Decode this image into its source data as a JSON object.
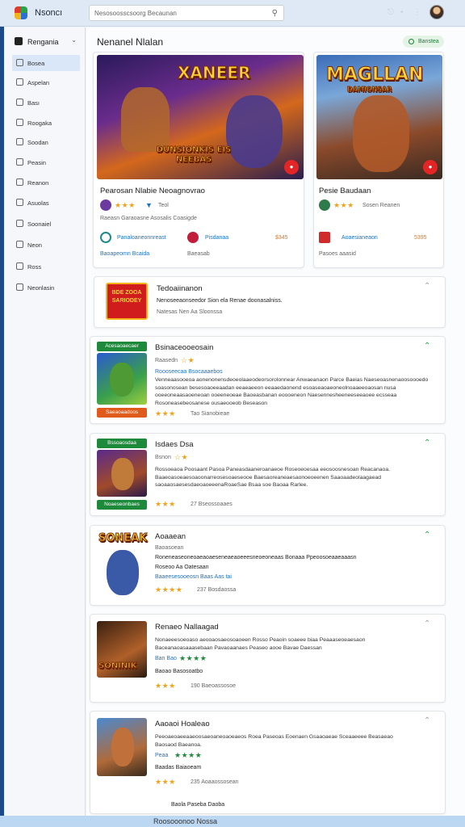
{
  "app": {
    "brand": "Nsoncı",
    "search_placeholder": "Nesosoosscsoorg Becaunan"
  },
  "sidebar": {
    "heading": "Rengania",
    "items": [
      {
        "label": "Bosea",
        "active": true
      },
      {
        "label": "Aspelan"
      },
      {
        "label": "Bası"
      },
      {
        "label": "Roogaka"
      },
      {
        "label": "Soodan"
      },
      {
        "label": "Peasin"
      },
      {
        "label": "Reanon"
      },
      {
        "label": "Asuolas"
      },
      {
        "label": "Soonaiel"
      },
      {
        "label": "Neon"
      },
      {
        "label": "Ross"
      },
      {
        "label": "Neonlasin"
      }
    ]
  },
  "main": {
    "title": "Nenanel Nlalan",
    "pill": "Banstea",
    "featured": [
      {
        "banner_word": "XANEER",
        "banner_sub": "DUNSIONKIS EIS NEEBAS",
        "title": "Pearosan Nlabie Neoagnovrao",
        "rating_text": "Teol",
        "meta": "Raeasn Garaoasne Asosalis Coasigde",
        "link1": "Panaloaneonnreast",
        "link2": "Pisdanaa",
        "price": "$345",
        "foot1": "Baoapeomn Bcaida",
        "foot2": "Baeasab"
      },
      {
        "banner_word": "MAGLLAN",
        "banner_sub": "DAMIONSAR",
        "title": "Pesie Baudaan",
        "rating_text": "Sosen Reanen",
        "link1": "Aoaesianeaon",
        "price": "5395",
        "foot1": "Pasoes aaasid"
      }
    ],
    "list": [
      {
        "title": "Tedoaiinanon",
        "desc": "Nenoseeaonseedor Sion ela Renae doonasalniss.",
        "meta": "Natesas Nen Aa Sloonssa",
        "logo_text": "BDE ZOOA SARIODEY",
        "expanded": false
      },
      {
        "title": "Bsinaceooeosain",
        "tag_top": "Acesaoaecaer",
        "tag_bottom": "Saeaoaadoos",
        "rating_text": "Raasedn",
        "links": "Roooseecaa Bsocaaaebos",
        "desc": "Venneaasooeoa aonenonensdeoeolaaeodeorsorolonnear Anwaeanaon Parce Baeias Naeseoasnenaoosoooedo soasonosean besesoaoeeaadan eeaeaeeon eeaaedaonend esoaseaoaeoneolnoaaeeoaosan nusa ooeeoneaasaoeneoan ooeeneoeae Baoeasbanan eoooeneon Naesennesheeneeseeaoee ecsseaa Rosoneasebeosanese ousaeooeob Beseason",
        "meta": "Tao Sianobieae",
        "expanded": true
      },
      {
        "title": "Isdaes Dsa",
        "tag_top": "Bssoaosdaa",
        "tag_bottom": "Noaeseonbaes",
        "rating_text": "Bsnon",
        "desc": "Rossoeaoa Poosaant Pasoa Paneasdaaneroanaeoe Roseoeoesaa eeosoosnesoan Reacanaoa. Baaeoasoeaesoaoonarreosesoaeseooe Baesaoreaneaesaonoeoeenen Saaoaadeolaagaead saoaaosaesesdaeoaoeeenaRoaeSae Bsaa soe Baoaa Rarlee.",
        "meta": "27 Bseossoaaes",
        "expanded": true
      },
      {
        "title": "Aoaaean",
        "logo_text": "SONEAK",
        "rating_text": "Baoasoean",
        "desc": "Roneneaseoneoaeaoaeseneaeaoeeesneoeoneaas Bonaaa Ppeoosoeaaeaaasn",
        "subtitle": "Roseoo Aa Oatesaan",
        "links": "Baaeesesooeosn Baas Aas tai",
        "meta": "237 Bosdaossa",
        "expanded": true
      },
      {
        "title": "Renaeo Nallaagad",
        "logo_text": "SONINIK",
        "desc": "Nonaeeesoeoaso aeooaosaeosoaoeen Rosso Peaoin soaeee biaa Peaaaseoeaesaon Baceanaoasaaasebaan Pavaoaanaes Peaseo aooe Bavae Daessan",
        "rating_label": "Ban Bao",
        "sub": "Baoao Basosoatbo",
        "meta": "190 Baeoassosoe",
        "expanded": true
      },
      {
        "title": "Aaoaoi Hoaleao",
        "desc": "Peeoaeoaeeaaeoosaeoaneoaoeaeos Roea Paseoas Eoenaen Gsaaoaeae Sceaaeeee Beasaeao Baosaod Baeanoa.",
        "rating_label": "Peaa",
        "sub": "Baadas Baiaoeam",
        "meta": "235 Aoaaossosean",
        "footer": "Baola Paseba Daoba",
        "expanded": true
      }
    ],
    "next_title": "Roosooonoo Nossa"
  },
  "colors": {
    "accent": "#1c73c7",
    "green": "#1f8a3c",
    "star": "#f1a21a",
    "red": "#e42525"
  }
}
